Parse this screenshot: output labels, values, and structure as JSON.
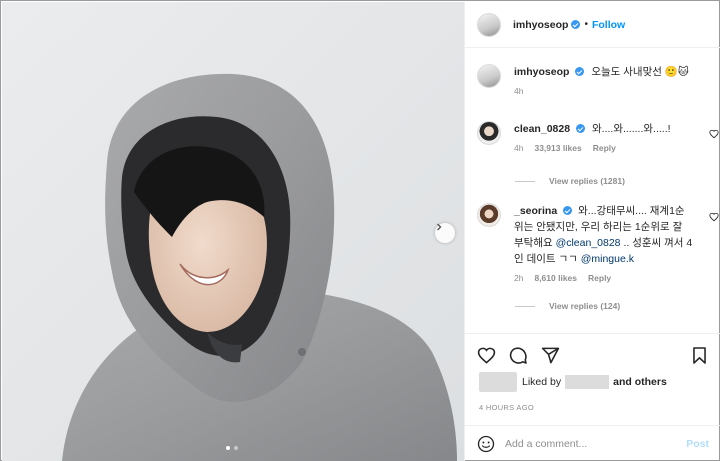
{
  "post": {
    "author": "imhyoseop",
    "follow_label": "Follow",
    "separator": "•",
    "carousel": {
      "current": 1,
      "total": 2
    }
  },
  "caption": {
    "username": "imhyoseop",
    "text": "오늘도 사내맞선 🙂🐱",
    "time": "4h"
  },
  "comments": [
    {
      "username": "clean_0828",
      "text": "와....와.......와.....!",
      "time": "4h",
      "likes": "33,913 likes",
      "reply_label": "Reply",
      "view_replies": "View replies (1281)"
    },
    {
      "username": "_seorina",
      "text_part1": "와...강태무씨.... 재계1순위는 안됐지만, 우리 하리는 1순위로 잘 부탁해요 ",
      "mention1": "@clean_0828",
      "text_part2": " .. 성훈씨 껴서 4인 데이트 ㄱㄱ ",
      "mention2": "@mingue.k",
      "time": "2h",
      "likes": "8,610 likes",
      "reply_label": "Reply",
      "view_replies": "View replies (124)"
    }
  ],
  "likes_summary": {
    "prefix": "Liked by",
    "suffix": "and others"
  },
  "timestamp": "4 HOURS AGO",
  "add_comment": {
    "placeholder": "Add a comment...",
    "post_label": "Post"
  },
  "icons": {
    "like": "heart-icon",
    "comment": "comment-icon",
    "share": "paper-plane-icon",
    "save": "bookmark-icon",
    "emoji": "smiley-icon",
    "next": "chevron-right-icon"
  },
  "colors": {
    "link": "#0095f6",
    "verified": "#3897f0",
    "muted": "#8e8e8e",
    "post_disabled": "#b2dffc"
  }
}
